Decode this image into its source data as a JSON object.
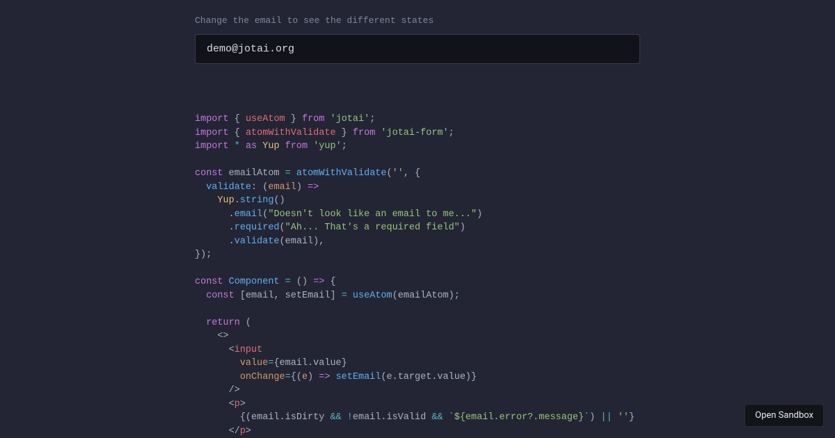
{
  "instruction": "Change the email to see the different states",
  "email_input": {
    "value": "demo@jotai.org"
  },
  "code": {
    "l1": {
      "import": "import",
      "lb": "{",
      "use_atom": "useAtom",
      "rb": "}",
      "from": "from",
      "pkg": "'jotai'",
      "semi": ";"
    },
    "l2": {
      "import": "import",
      "lb": "{",
      "awv": "atomWithValidate",
      "rb": "}",
      "from": "from",
      "pkg": "'jotai-form'",
      "semi": ";"
    },
    "l3": {
      "import": "import",
      "star": "*",
      "as": "as",
      "yup": "Yup",
      "from": "from",
      "pkg": "'yup'",
      "semi": ";"
    },
    "l5": {
      "const": "const",
      "emailAtom": "emailAtom",
      "eq": "=",
      "awv": "atomWithValidate",
      "lp": "(",
      "empty": "''",
      "comma": ",",
      "lb": "{"
    },
    "l6": {
      "validate": "validate",
      "colon": ":",
      "lp": "(",
      "email": "email",
      "rp": ")",
      "arrow": "=>"
    },
    "l7": {
      "yup": "Yup",
      "dot": ".",
      "string": "string",
      "paren": "()"
    },
    "l8": {
      "dot": ".",
      "email": "email",
      "lp": "(",
      "msg": "\"Doesn't look like an email to me...\"",
      "rp": ")"
    },
    "l9": {
      "dot": ".",
      "required": "required",
      "lp": "(",
      "msg": "\"Ah... That's a required field\"",
      "rp": ")"
    },
    "l10": {
      "dot": ".",
      "validate": "validate",
      "lp": "(",
      "email": "email",
      "rp": ")",
      "comma": ","
    },
    "l11": {
      "close": "});"
    },
    "l13": {
      "const": "const",
      "comp": "Component",
      "eq": "=",
      "lp": "(",
      "rp": ")",
      "arrow": "=>",
      "lb": "{"
    },
    "l14": {
      "const": "const",
      "lbr": "[",
      "email": "email",
      "comma": ",",
      "setEmail": "setEmail",
      "rbr": "]",
      "eq": "=",
      "useAtom": "useAtom",
      "lp": "(",
      "emailAtom": "emailAtom",
      "rp": ")",
      "semi": ";"
    },
    "l16": {
      "return": "return",
      "lp": "("
    },
    "l17": {
      "frag": "<>"
    },
    "l18": {
      "lt": "<",
      "input": "input"
    },
    "l19": {
      "value": "value",
      "eq": "=",
      "lb": "{",
      "expr": "email.value",
      "rb": "}"
    },
    "l20": {
      "onChange": "onChange",
      "eq": "=",
      "lb": "{(",
      "e": "e",
      "rp": ")",
      "arrow": "=>",
      "setEmail": "setEmail",
      "lp2": "(",
      "expr": "e.target.value",
      "rp2": ")",
      "rb": "}"
    },
    "l21": {
      "close": "/>"
    },
    "l22": {
      "lt": "<",
      "p": "p",
      "gt": ">"
    },
    "l23": {
      "lb": "{(",
      "expr1": "email.isDirty",
      "and1": "&&",
      "bang": "!",
      "expr2": "email.isValid",
      "and2": "&&",
      "tmpl": "`${email.error?.message}`",
      "rp": ")",
      "or": "||",
      "empty": "''",
      "rb": "}"
    },
    "l24": {
      "lt": "</",
      "p": "p",
      "gt": ">"
    }
  },
  "sandbox_button": "Open Sandbox"
}
